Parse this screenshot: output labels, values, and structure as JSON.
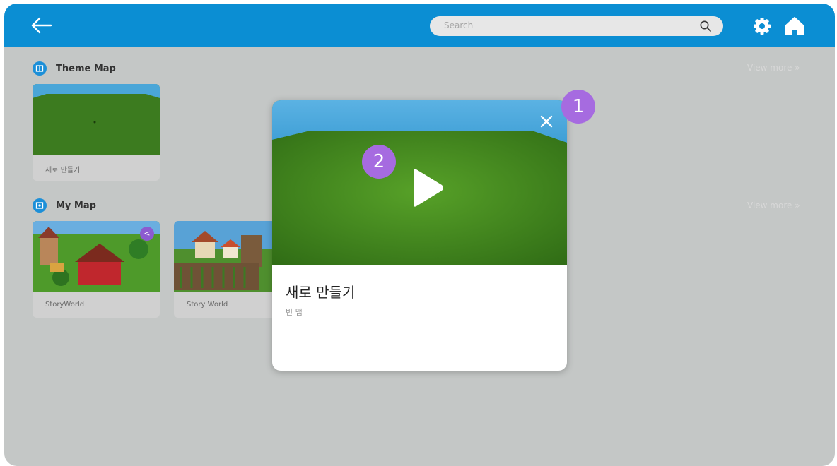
{
  "header": {
    "search_placeholder": "Search",
    "icons": [
      "back-arrow-icon",
      "search-icon",
      "gear-icon",
      "home-icon"
    ],
    "accent": "#0b8ed3"
  },
  "sections": [
    {
      "title": "Theme Map",
      "view_more": "View more »",
      "cards": [
        {
          "label": "새로 만들기"
        }
      ]
    },
    {
      "title": "My Map",
      "view_more": "View more »",
      "cards": [
        {
          "label": "StoryWorld"
        },
        {
          "label": "Story World"
        }
      ]
    }
  ],
  "modal": {
    "title": "새로 만들기",
    "subtitle": "빈 맵"
  },
  "annotations": {
    "close_badge": "1",
    "play_badge": "2",
    "color": "#a66be0"
  }
}
